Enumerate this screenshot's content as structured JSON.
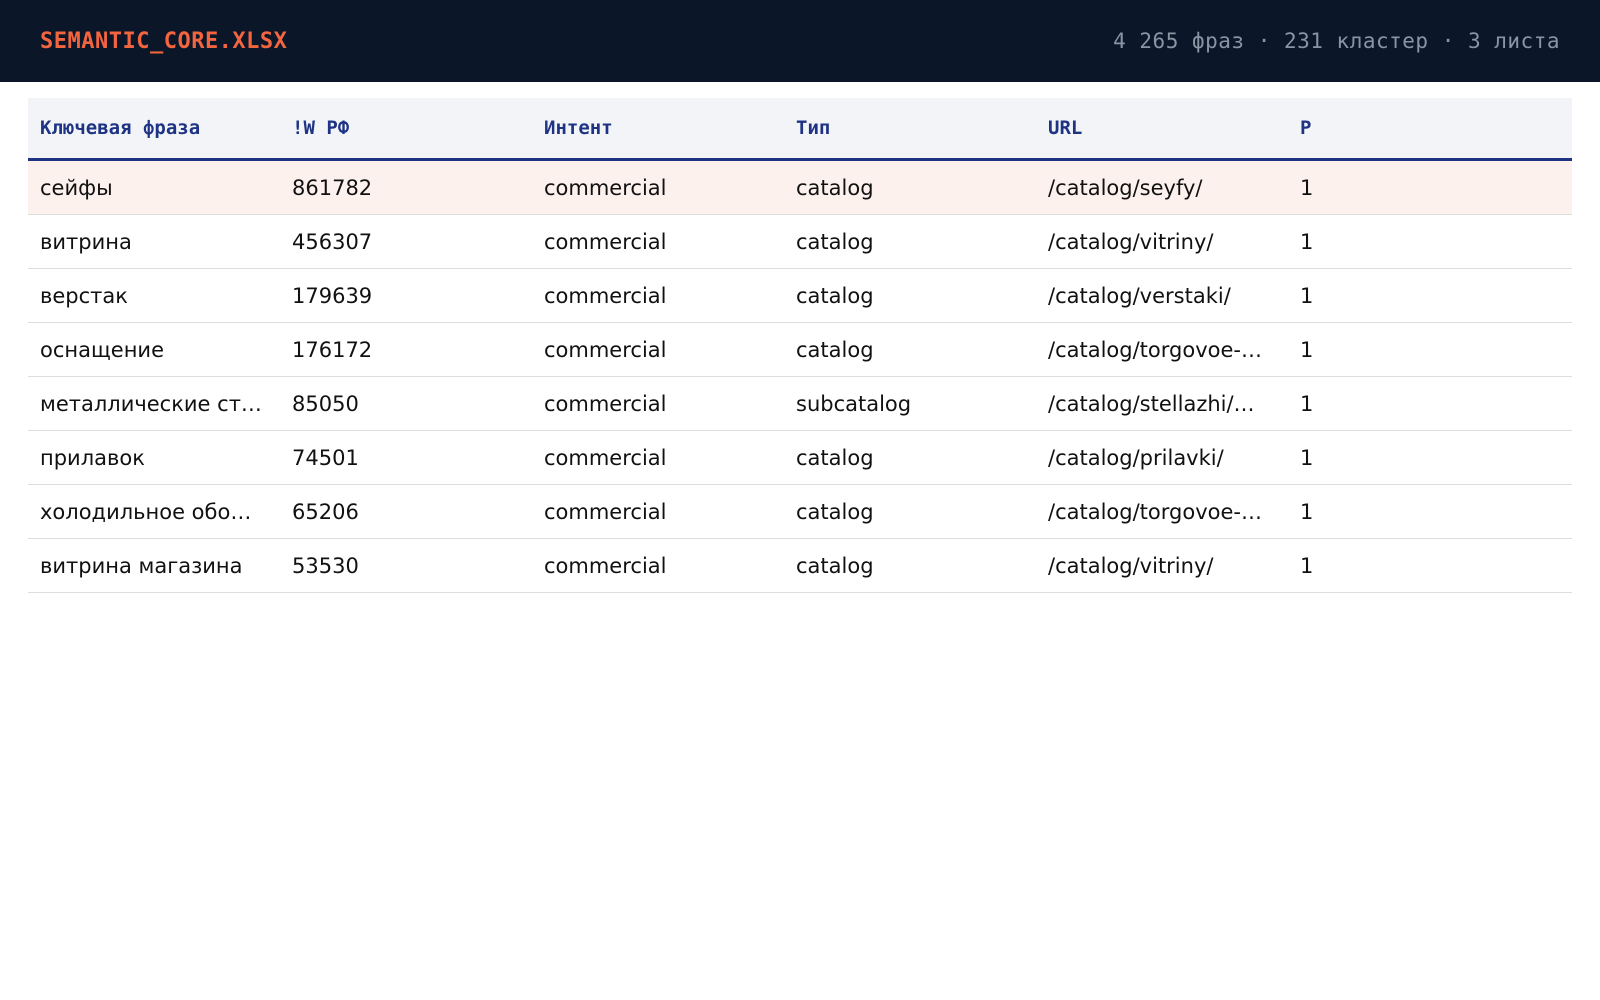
{
  "header": {
    "file_title": "SEMANTIC_CORE.XLSX",
    "stats": "4 265 фраз · 231 кластер · 3 листа"
  },
  "table": {
    "columns": [
      "Ключевая фраза",
      "!W РФ",
      "Интент",
      "Тип",
      "URL",
      "P"
    ],
    "rows": [
      [
        "сейфы",
        "861782",
        "commercial",
        "catalog",
        "/catalog/seyfy/",
        "1"
      ],
      [
        "витрина",
        "456307",
        "commercial",
        "catalog",
        "/catalog/vitriny/",
        "1"
      ],
      [
        "верстак",
        "179639",
        "commercial",
        "catalog",
        "/catalog/verstaki/",
        "1"
      ],
      [
        "оснащение",
        "176172",
        "commercial",
        "catalog",
        "/catalog/torgovoe-…",
        "1"
      ],
      [
        "металлические ст…",
        "85050",
        "commercial",
        "subcatalog",
        "/catalog/stellazhi/…",
        "1"
      ],
      [
        "прилавок",
        "74501",
        "commercial",
        "catalog",
        "/catalog/prilavki/",
        "1"
      ],
      [
        "холодильное обо…",
        "65206",
        "commercial",
        "catalog",
        "/catalog/torgovoe-…",
        "1"
      ],
      [
        "витрина магазина",
        "53530",
        "commercial",
        "catalog",
        "/catalog/vitriny/",
        "1"
      ]
    ]
  },
  "colors": {
    "header_bg": "#0b1629",
    "accent": "#f2653f",
    "table_header_text": "#1e3384",
    "highlight_row": "#fdf1ee"
  }
}
